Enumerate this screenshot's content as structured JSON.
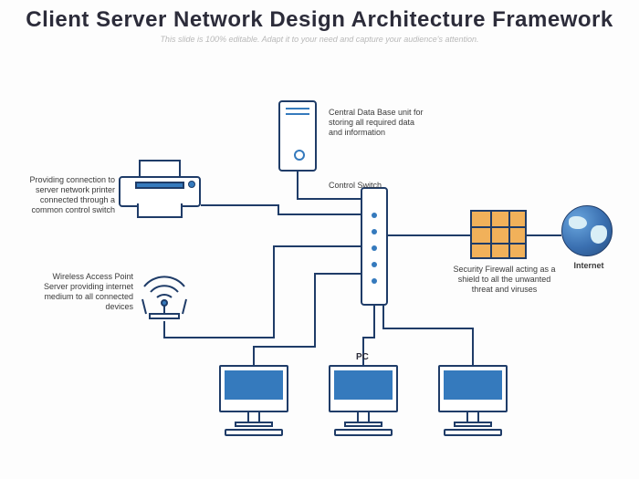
{
  "title": "Client Server Network Design Architecture Framework",
  "subtitle": "This slide is 100% editable. Adapt it to your need and capture your audience's attention.",
  "labels": {
    "printer": "Providing connection to server network printer connected through a common control switch",
    "server": "Central Data Base unit for storing all required data and information",
    "switch": "Control Switch",
    "wifi": "Wireless Access Point Server providing internet medium to all connected devices",
    "firewall": "Security Firewall acting as a shield to all the unwanted threat and viruses",
    "internet": "Internet",
    "pc": "PC"
  }
}
